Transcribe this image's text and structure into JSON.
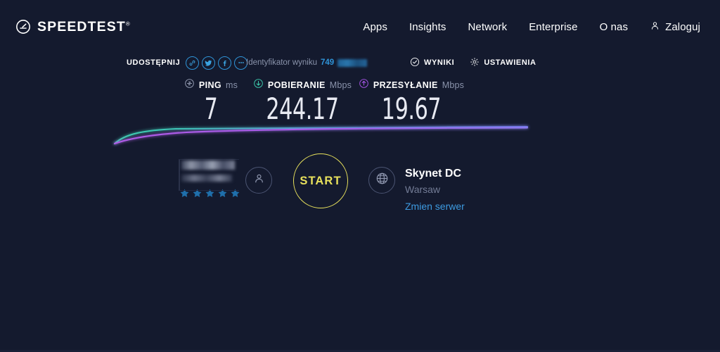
{
  "brand": {
    "name": "SPEEDTEST",
    "trademark": "®",
    "logo_icon": "speedtest-gauge-icon"
  },
  "nav": {
    "items": [
      {
        "label": "Apps"
      },
      {
        "label": "Insights"
      },
      {
        "label": "Network"
      },
      {
        "label": "Enterprise"
      },
      {
        "label": "O nas"
      }
    ],
    "login": {
      "label": "Zaloguj",
      "icon": "person-icon"
    }
  },
  "share": {
    "label": "UDOSTĘPNIJ",
    "icons": [
      {
        "name": "link-icon"
      },
      {
        "name": "twitter-icon"
      },
      {
        "name": "facebook-icon"
      },
      {
        "name": "more-icon"
      }
    ],
    "result_id_label": "Identyfikator wyniku",
    "result_id_value": "749",
    "result_id_redacted": true,
    "actions": [
      {
        "label": "WYNIKI",
        "icon": "check-circle-icon"
      },
      {
        "label": "USTAWIENIA",
        "icon": "gear-icon"
      }
    ]
  },
  "metrics": {
    "ping": {
      "name": "PING",
      "unit": "ms",
      "value": "7",
      "icon": "ping-icon",
      "color": "#8a93ab"
    },
    "download": {
      "name": "POBIERANIE",
      "unit": "Mbps",
      "value": "244.17",
      "icon": "download-arrow-icon",
      "color": "#3ecfb0"
    },
    "upload": {
      "name": "PRZESYŁANIE",
      "unit": "Mbps",
      "value": "19.67",
      "icon": "upload-arrow-icon",
      "color": "#a855e8"
    }
  },
  "chart_data": {
    "type": "line",
    "title": "",
    "xlabel": "",
    "ylabel": "",
    "series": [
      {
        "name": "POBIERANIE",
        "color": "#3ecfb0",
        "values": [
          0,
          55,
          78,
          88,
          93,
          96,
          97,
          98,
          99,
          99,
          100,
          100
        ]
      },
      {
        "name": "PRZESYŁANIE",
        "color": "#a855e8",
        "values": [
          0,
          30,
          55,
          70,
          80,
          87,
          91,
          94,
          96,
          98,
          99,
          100
        ]
      }
    ],
    "x": [
      0,
      1,
      2,
      3,
      4,
      5,
      6,
      7,
      8,
      9,
      10,
      11
    ],
    "grid": false,
    "legend": "none"
  },
  "isp": {
    "name_redacted": true,
    "rating_stars": 5,
    "star_color": "#1f6fab",
    "icon": "person-icon"
  },
  "start": {
    "label": "START",
    "color": "#e8e15c"
  },
  "server": {
    "name": "Skynet DC",
    "city": "Warsaw",
    "change_label": "Zmien serwer",
    "icon": "globe-icon"
  },
  "colors": {
    "background": "#141a2e",
    "accent_blue": "#3d9ae0",
    "download": "#3ecfb0",
    "upload": "#a855e8",
    "start": "#e8e15c"
  }
}
